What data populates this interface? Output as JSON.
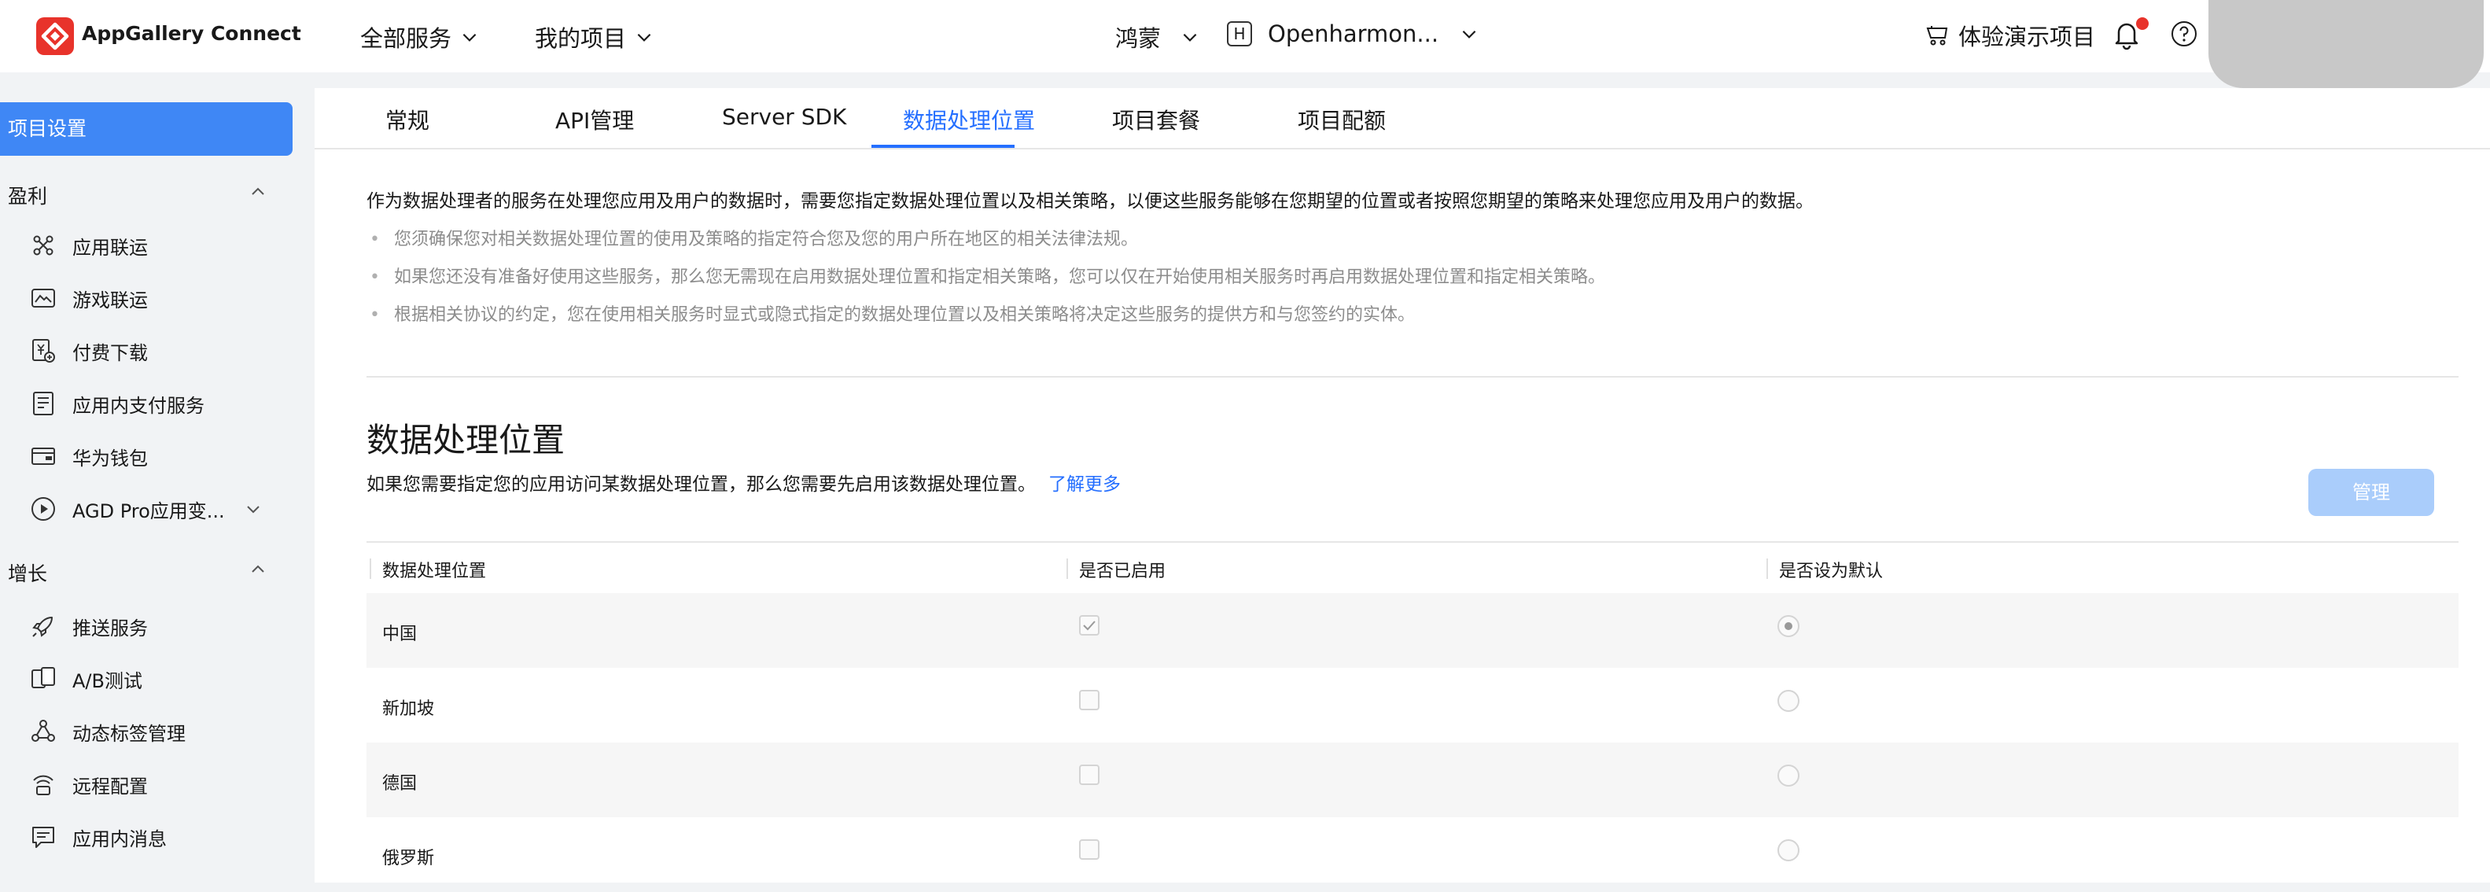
{
  "header": {
    "brand": "AppGallery Connect",
    "nav_all_services": "全部服务",
    "nav_my_projects": "我的项目",
    "os_selector": "鸿蒙",
    "project_badge": "H",
    "project_name": "Openharmon...",
    "demo_project": "体验演示项目",
    "notification_dot_color": "#e8332b"
  },
  "sidebar": {
    "active_item": "项目设置",
    "groups": [
      {
        "title": "盈利",
        "items": [
          {
            "label": "应用联运",
            "icon": "app-distribution-icon"
          },
          {
            "label": "游戏联运",
            "icon": "game-distribution-icon"
          },
          {
            "label": "付费下载",
            "icon": "paid-download-icon"
          },
          {
            "label": "应用内支付服务",
            "icon": "in-app-payment-icon"
          },
          {
            "label": "华为钱包",
            "icon": "wallet-icon"
          },
          {
            "label": "AGD Pro应用变...",
            "icon": "agd-pro-icon"
          }
        ]
      },
      {
        "title": "增长",
        "items": [
          {
            "label": "推送服务",
            "icon": "rocket-icon"
          },
          {
            "label": "A/B测试",
            "icon": "ab-test-icon"
          },
          {
            "label": "动态标签管理",
            "icon": "dynamic-tag-icon"
          },
          {
            "label": "远程配置",
            "icon": "remote-config-icon"
          },
          {
            "label": "应用内消息",
            "icon": "in-app-message-icon"
          }
        ]
      }
    ]
  },
  "tabs": [
    {
      "label": "常规",
      "active": false
    },
    {
      "label": "API管理",
      "active": false
    },
    {
      "label": "Server SDK",
      "active": false
    },
    {
      "label": "数据处理位置",
      "active": true
    },
    {
      "label": "项目套餐",
      "active": false
    },
    {
      "label": "项目配额",
      "active": false
    }
  ],
  "intro": {
    "main": "作为数据处理者的服务在处理您应用及用户的数据时，需要您指定数据处理位置以及相关策略，以便这些服务能够在您期望的位置或者按照您期望的策略来处理您应用及用户的数据。",
    "bullets": [
      "您须确保您对相关数据处理位置的使用及策略的指定符合您及您的用户所在地区的相关法律法规。",
      "如果您还没有准备好使用这些服务，那么您无需现在启用数据处理位置和指定相关策略，您可以仅在开始使用相关服务时再启用数据处理位置和指定相关策略。",
      "根据相关协议的约定，您在使用相关服务时显式或隐式指定的数据处理位置以及相关策略将决定这些服务的提供方和与您签约的实体。"
    ]
  },
  "section": {
    "title": "数据处理位置",
    "subtitle": "如果您需要指定您的应用访问某数据处理位置，那么您需要先启用该数据处理位置。",
    "learn_more": "了解更多",
    "manage_button": "管理"
  },
  "table": {
    "columns": [
      "数据处理位置",
      "是否已启用",
      "是否设为默认"
    ],
    "rows": [
      {
        "location": "中国",
        "enabled": true,
        "default": true
      },
      {
        "location": "新加坡",
        "enabled": false,
        "default": false
      },
      {
        "location": "德国",
        "enabled": false,
        "default": false
      },
      {
        "location": "俄罗斯",
        "enabled": false,
        "default": false
      }
    ]
  },
  "colors": {
    "accent": "#256fff",
    "sidebar_active": "#3f87f5",
    "manage_button_disabled": "#aacdfb"
  }
}
